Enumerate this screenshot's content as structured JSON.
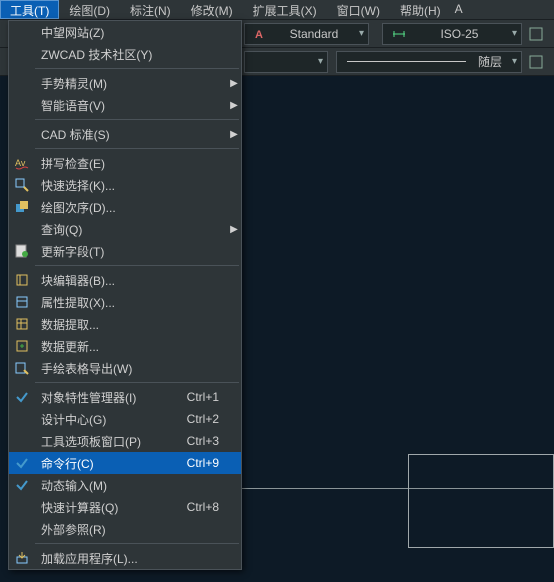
{
  "menubar": {
    "tools": "工具(T)",
    "draw": "绘图(D)",
    "dimension": "标注(N)",
    "modify": "修改(M)",
    "extension": "扩展工具(X)",
    "window": "窗口(W)",
    "help": "帮助(H)",
    "cutoff": "A"
  },
  "toolbar": {
    "style_box": "Standard",
    "dimstyle_box": "ISO-25",
    "layer_line": "随层"
  },
  "menu": {
    "zw_site": {
      "label": "中望网站(Z)"
    },
    "zw_community": {
      "label": "ZWCAD 技术社区(Y)"
    },
    "gesture": {
      "label": "手势精灵(M)"
    },
    "voice": {
      "label": "智能语音(V)"
    },
    "cad_standard": {
      "label": "CAD 标准(S)"
    },
    "spell": {
      "label": "拼写检查(E)"
    },
    "quick_select": {
      "label": "快速选择(K)..."
    },
    "draw_order": {
      "label": "绘图次序(D)..."
    },
    "inquiry": {
      "label": "查询(Q)"
    },
    "update_fields": {
      "label": "更新字段(T)"
    },
    "block_editor": {
      "label": "块编辑器(B)..."
    },
    "attr_extract": {
      "label": "属性提取(X)..."
    },
    "data_extract": {
      "label": "数据提取..."
    },
    "data_update": {
      "label": "数据更新..."
    },
    "hand_table": {
      "label": "手绘表格导出(W)"
    },
    "props_mgr": {
      "label": "对象特性管理器(I)",
      "shortcut": "Ctrl+1"
    },
    "design_ctr": {
      "label": "设计中心(G)",
      "shortcut": "Ctrl+2"
    },
    "tool_palette": {
      "label": "工具选项板窗口(P)",
      "shortcut": "Ctrl+3"
    },
    "cmdline": {
      "label": "命令行(C)",
      "shortcut": "Ctrl+9"
    },
    "dyn_input": {
      "label": "动态输入(M)"
    },
    "quick_calc": {
      "label": "快速计算器(Q)",
      "shortcut": "Ctrl+8"
    },
    "xref": {
      "label": "外部参照(R)"
    },
    "load_app": {
      "label": "加载应用程序(L)..."
    }
  }
}
